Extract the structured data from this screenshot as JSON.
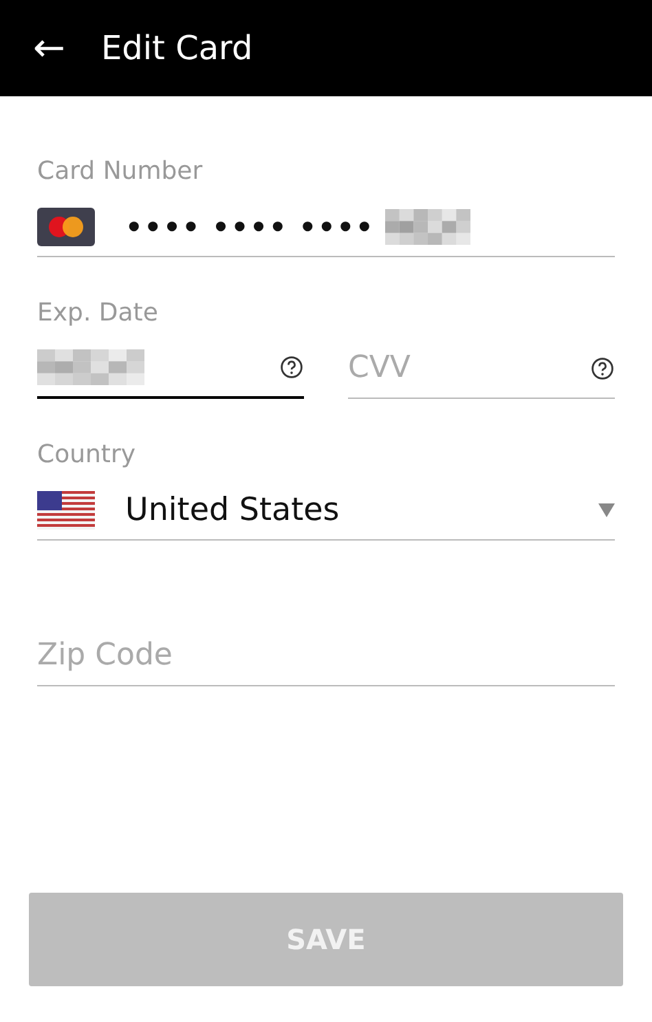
{
  "header": {
    "back_icon": "←",
    "title": "Edit Card"
  },
  "card_number": {
    "label": "Card Number",
    "value": "•••• •••• ••••",
    "redacted": true
  },
  "exp_date": {
    "label": "Exp. Date",
    "redacted": true,
    "focused": true
  },
  "cvv": {
    "placeholder": "CVV",
    "focused": false
  },
  "country": {
    "label": "Country",
    "value": "United States"
  },
  "zip": {
    "placeholder": "Zip Code"
  },
  "save_button": {
    "label": "SAVE",
    "disabled": true
  }
}
